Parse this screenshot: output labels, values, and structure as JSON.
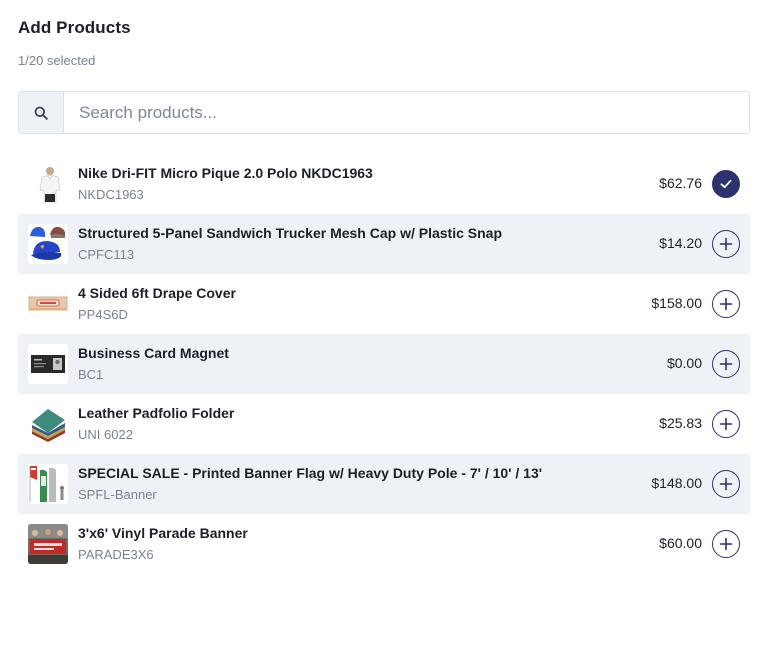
{
  "header": {
    "title": "Add Products",
    "selected_count": "1/20 selected"
  },
  "search": {
    "placeholder": "Search products...",
    "value": ""
  },
  "colors": {
    "accent": "#2d3170",
    "row_alt": "#eef2f6",
    "muted_text": "#7a8290"
  },
  "products": [
    {
      "name": "Nike Dri-FIT Micro Pique 2.0 Polo NKDC1963",
      "sku": "NKDC1963",
      "price": "$62.76",
      "selected": true,
      "icon": "check-icon"
    },
    {
      "name": "Structured 5-Panel Sandwich Trucker Mesh Cap w/ Plastic Snap",
      "sku": "CPFC113",
      "price": "$14.20",
      "selected": false,
      "icon": "plus-icon"
    },
    {
      "name": "4 Sided 6ft Drape Cover",
      "sku": "PP4S6D",
      "price": "$158.00",
      "selected": false,
      "icon": "plus-icon"
    },
    {
      "name": "Business Card Magnet",
      "sku": "BC1",
      "price": "$0.00",
      "selected": false,
      "icon": "plus-icon"
    },
    {
      "name": "Leather Padfolio Folder",
      "sku": "UNI 6022",
      "price": "$25.83",
      "selected": false,
      "icon": "plus-icon"
    },
    {
      "name": "SPECIAL SALE - Printed Banner Flag w/ Heavy Duty Pole - 7' / 10' / 13'",
      "sku": "SPFL-Banner",
      "price": "$148.00",
      "selected": false,
      "icon": "plus-icon"
    },
    {
      "name": "3'x6' Vinyl Parade Banner",
      "sku": "PARADE3X6",
      "price": "$60.00",
      "selected": false,
      "icon": "plus-icon"
    }
  ]
}
